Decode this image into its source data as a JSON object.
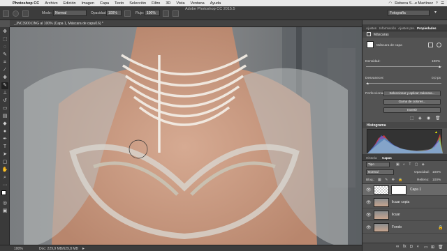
{
  "menubar": {
    "apple": "",
    "app": "Photoshop CC",
    "items": [
      "Archivo",
      "Edición",
      "Imagen",
      "Capa",
      "Texto",
      "Selección",
      "Filtro",
      "3D",
      "Vista",
      "Ventana",
      "Ayuda"
    ],
    "user": "Rebeca S...e Martínez"
  },
  "options": {
    "window_title": "Adobe Photoshop CC 2015.5",
    "mode_label": "Modo:",
    "mode_value": "Normal",
    "opacity_label": "Opacidad:",
    "opacity_value": "100%",
    "flow_label": "Flujo:",
    "flow_value": "100%",
    "workspace": "Fotografía"
  },
  "document": {
    "tab_title": "_JNC3900.DNG al 100% (Capa 1, Máscara de capa/16) *"
  },
  "status": {
    "zoom": "100%",
    "doc": "Doc: 229,9 MB/629,8 MB"
  },
  "panels": {
    "top_tabs": [
      "Ajustes",
      "Información",
      "Ajustes pre.",
      "Propiedades"
    ],
    "active_top_tab": "Propiedades",
    "properties": {
      "title": "Máscaras",
      "mask_label": "Máscara de capa",
      "density_label": "Densidad:",
      "density_value": "100%",
      "feather_label": "Desvanecer:",
      "feather_value": "0,0 px",
      "refine_label": "Perfeccionar:",
      "refine_button": "Seleccionar y aplicar máscara...",
      "color_range_button": "Gama de colores...",
      "invert_button": "Invertir"
    },
    "histogram_title": "Histograma",
    "layers_tabs": [
      "Historia",
      "Capas"
    ],
    "active_layers_tab": "Capas",
    "filter_label": "Tipo",
    "blend_mode": "Normal",
    "opacity_label": "Opacidad:",
    "opacity_value": "100%",
    "lock_label": "Bloq.:",
    "fill_label": "Relleno:",
    "fill_value": "100%",
    "layers": [
      {
        "name": "Capa 1"
      },
      {
        "name": "licuar copia"
      },
      {
        "name": "licuar"
      },
      {
        "name": "Fondo"
      }
    ],
    "footer_icons": [
      "link-icon",
      "fx-icon",
      "mask-icon",
      "adjustment-icon",
      "folder-icon",
      "new-layer-icon",
      "trash-icon"
    ]
  },
  "colors": {
    "menubar_bg": "#e8e8e8",
    "ui_dark": "#3c3c3c",
    "panel_bg": "#535353",
    "selected_layer": "#6a6a6a",
    "active_tab_text": "#ffffff"
  }
}
